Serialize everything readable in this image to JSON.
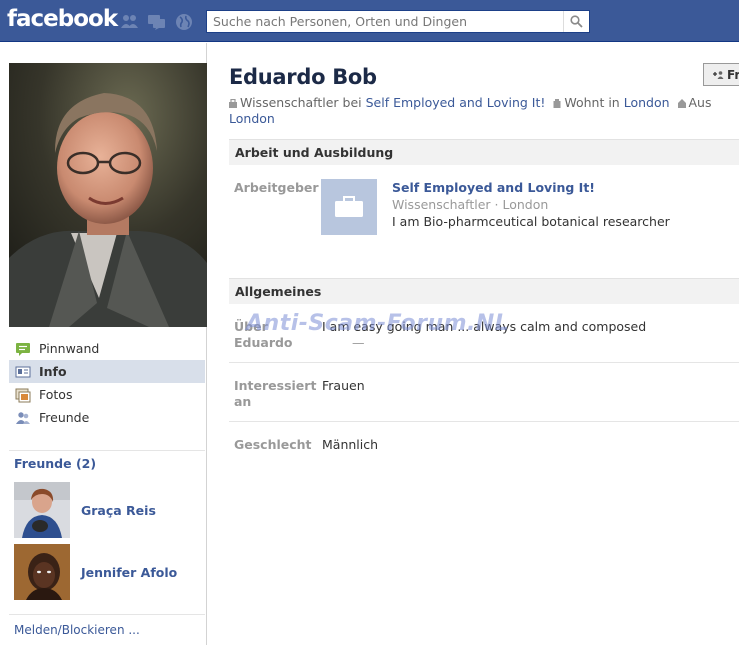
{
  "header": {
    "logo": "facebook",
    "search_placeholder": "Suche nach Personen, Orten und Dingen"
  },
  "profile": {
    "name": "Eduardo Bob",
    "friend_button": "Fr",
    "info_job_prefix": "Wissenschaftler bei",
    "info_job_link": "Self Employed and Loving It!",
    "info_lives_prefix": "Wohnt in",
    "info_lives_link": "London",
    "info_from_prefix": "Aus",
    "info_from_link": "London"
  },
  "nav": [
    {
      "label": "Pinnwand",
      "icon": "wall-icon"
    },
    {
      "label": "Info",
      "icon": "info-icon"
    },
    {
      "label": "Fotos",
      "icon": "photos-icon"
    },
    {
      "label": "Freunde",
      "icon": "friends-icon"
    }
  ],
  "friends": {
    "heading": "Freunde (2)",
    "list": [
      {
        "name": "Graça Reis"
      },
      {
        "name": "Jennifer Afolo"
      }
    ]
  },
  "report_link": "Melden/Blockieren ...",
  "work": {
    "heading": "Arbeit und Ausbildung",
    "label": "Arbeitgeber",
    "employer": "Self Employed and Loving It!",
    "position": "Wissenschaftler · London",
    "description": "I am Bio-pharmceutical botanical researcher"
  },
  "general": {
    "heading": "Allgemeines",
    "about_label_1": "Über",
    "about_label_2": "Eduardo",
    "about_value": "I am easy going man ... always calm and composed",
    "about_dash": "—",
    "interested_label_1": "Interessiert",
    "interested_label_2": "an",
    "interested_value": "Frauen",
    "gender_label": "Geschlecht",
    "gender_value": "Männlich"
  },
  "watermark": "Anti-Scam-Forum.NL",
  "colors": {
    "brand": "#3b5998",
    "active_nav": "#d8dfea"
  }
}
